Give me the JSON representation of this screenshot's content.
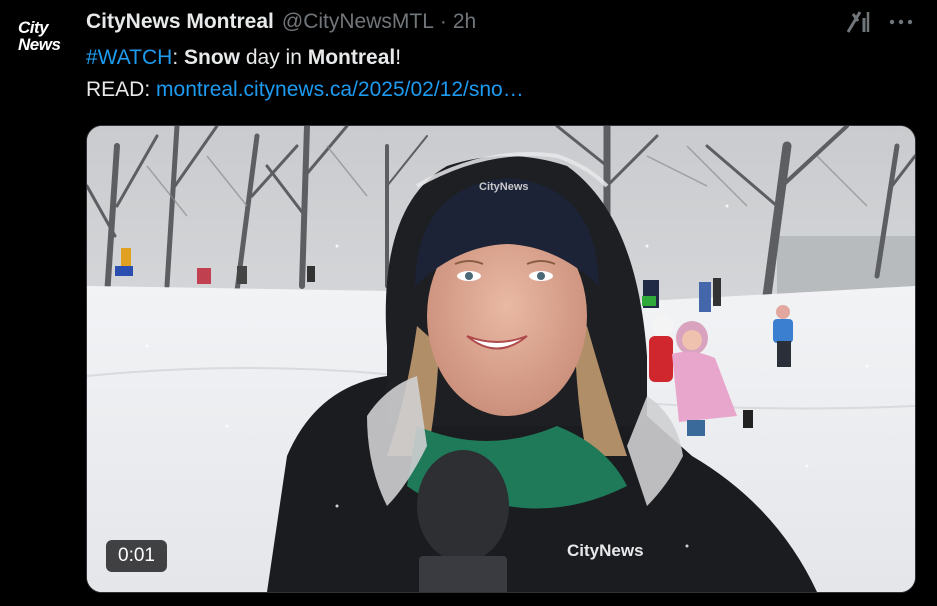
{
  "tweet": {
    "avatar": {
      "line1": "City",
      "line2": "News"
    },
    "author_name": "CityNews Montreal",
    "author_handle": "@CityNewsMTL",
    "separator": "·",
    "time": "2h",
    "text": {
      "hashtag": "#WATCH",
      "p1": ": ",
      "b1": "Snow",
      "p2": " day in ",
      "b2": "Montreal",
      "p3": "!",
      "read_label": "READ: ",
      "link": "montreal.citynews.ca/2025/02/12/sno…"
    },
    "video": {
      "timestamp": "0:01",
      "hat_logo": "CityNews",
      "jacket_logo": "CityNews"
    }
  },
  "icons": {
    "grok": "grok-icon",
    "more": "more-icon"
  },
  "colors": {
    "background": "#000000",
    "link": "#1d9bf0",
    "text": "#e7e9ea",
    "muted": "#71767b"
  }
}
